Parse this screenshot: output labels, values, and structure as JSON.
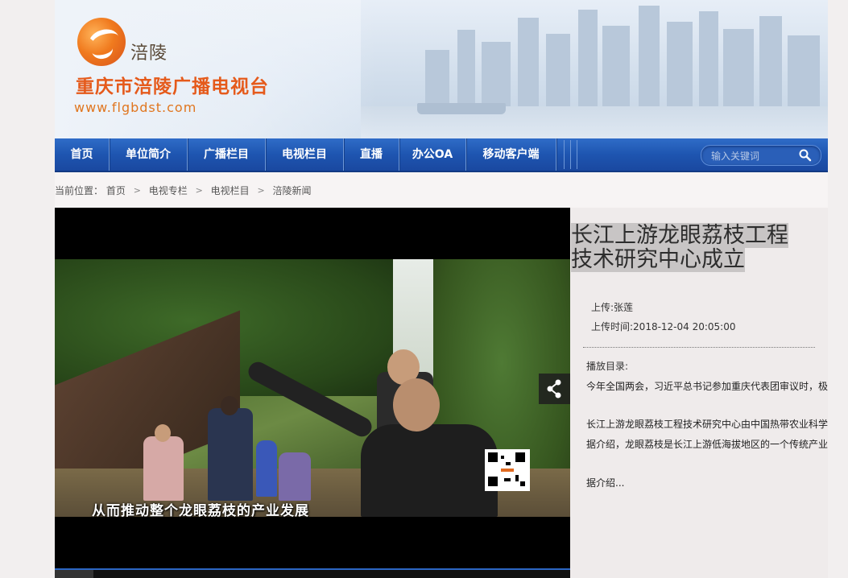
{
  "header": {
    "logo_city": "涪陵",
    "logo_name": "重庆市涪陵广播电视台",
    "logo_url": "www.flgbdst.com"
  },
  "nav": {
    "items": [
      "首页",
      "单位简介",
      "广播栏目",
      "电视栏目",
      "直播",
      "办公OA",
      "移动客户端"
    ],
    "search_placeholder": "输入关键词"
  },
  "breadcrumb": {
    "prefix": "当前位置：",
    "items": [
      "首页",
      "电视专栏",
      "电视栏目",
      "涪陵新闻"
    ]
  },
  "player": {
    "subtitle": "从而推动整个龙眼荔枝的产业发展"
  },
  "article": {
    "title": "长江上游龙眼荔枝工程技术研究中心成立",
    "title_line1": "长江上游龙眼荔枝工程",
    "title_line2": "技术研究中心成立",
    "uploader": "上传:张莲",
    "upload_time": "上传时间:2018-12-04 20:05:00",
    "playlist_label": "播放目录:",
    "playlist": [
      "今年全国两会，习近平总书记参加重庆代表团审议时，极",
      "长江上游龙眼荔枝工程技术研究中心由中国热带农业科学",
      "据介绍，龙眼荔枝是长江上游低海拔地区的一个传统产业",
      "据介绍..."
    ]
  },
  "colors": {
    "nav_blue": "#1e55b0",
    "logo_orange": "#e55a1b"
  }
}
